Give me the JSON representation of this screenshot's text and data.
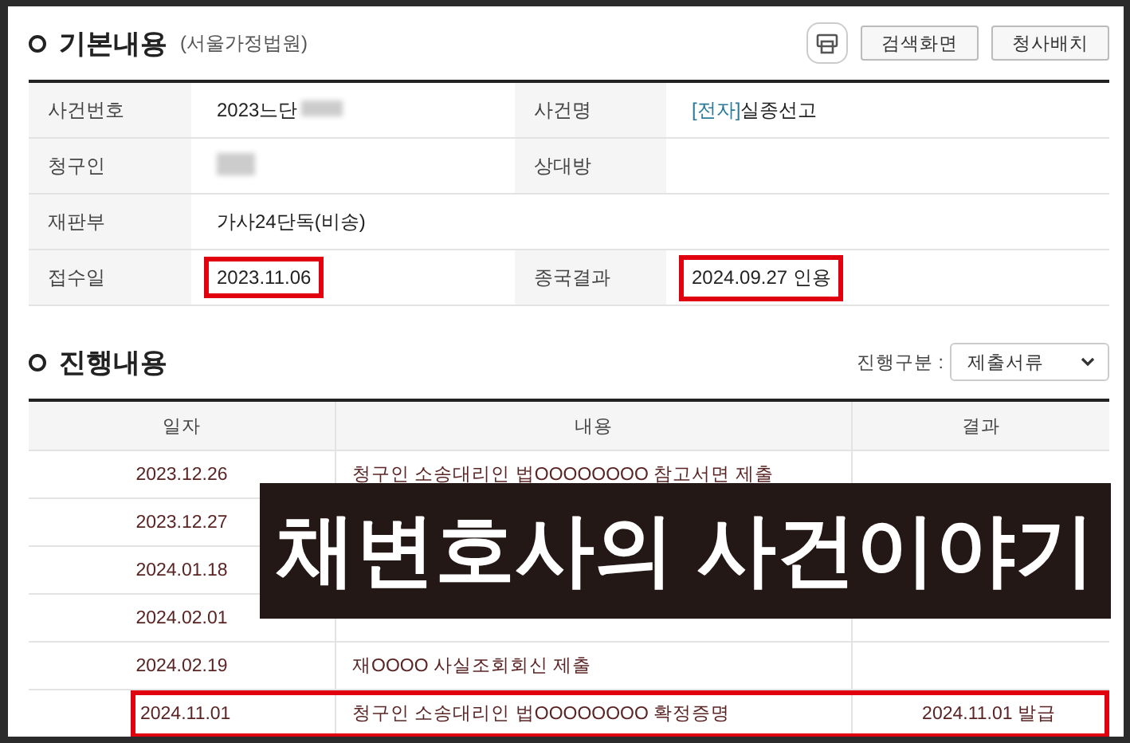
{
  "basic_info": {
    "title": "기본내용",
    "court": "(서울가정법원)",
    "buttons": [
      "검색화면",
      "청사배치"
    ],
    "rows": [
      [
        {
          "label": "사건번호",
          "value": "2023느단",
          "redacted": true,
          "highlighted": false
        },
        {
          "label": "사건명",
          "prefix": "[전자]",
          "value": "실종선고",
          "redacted": false,
          "highlighted": false
        }
      ],
      [
        {
          "label": "청구인",
          "redacted": true,
          "highlighted": false
        },
        {
          "label": "상대방",
          "redacted": false,
          "highlighted": false
        }
      ],
      [
        {
          "label": "재판부",
          "value": "가사24단독(비송)",
          "redacted": false,
          "highlighted": false
        }
      ],
      [
        {
          "label": "접수일",
          "value": "2023.11.06",
          "redacted": false,
          "highlighted": true
        },
        {
          "label": "종국결과",
          "value": "2024.09.27 인용",
          "redacted": false,
          "highlighted": true
        }
      ]
    ]
  },
  "progress": {
    "title": "진행내용",
    "filter_label": "진행구분 :",
    "filter_value": "제출서류",
    "columns": [
      "일자",
      "내용",
      "결과"
    ],
    "rows": [
      {
        "date": "2023.12.26",
        "content": "청구인 소송대리인 법OOOOOOOO 참고서면 제출",
        "highlighted": false
      },
      {
        "date": "2023.12.27",
        "highlighted": false
      },
      {
        "date": "2024.01.18",
        "highlighted": false
      },
      {
        "date": "2024.02.01",
        "highlighted": false
      },
      {
        "date": "2024.02.19",
        "content": "재OOOO 사실조회회신 제출",
        "highlighted": false
      },
      {
        "date": "2024.11.01",
        "content": "청구인 소송대리인 법OOOOOOOO 확정증명",
        "result": "2024.11.01 발급",
        "highlighted": true
      }
    ]
  },
  "overlay_banner": {
    "text": "채변호사의 사건이야기"
  }
}
